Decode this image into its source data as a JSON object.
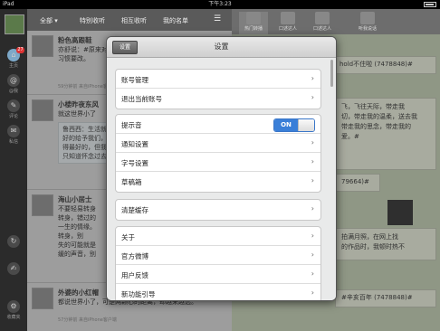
{
  "statusbar": {
    "carrier": "iPad",
    "time": "下午3:23"
  },
  "rail": {
    "items": [
      {
        "label": "主页",
        "icon": "home-icon"
      },
      {
        "label": "@我",
        "icon": "at-icon"
      },
      {
        "label": "评论",
        "icon": "comment-icon"
      },
      {
        "label": "私信",
        "icon": "message-icon"
      },
      {
        "label": "",
        "icon": "refresh-icon"
      },
      {
        "label": "",
        "icon": "compose-icon"
      },
      {
        "label": "收藏夹",
        "icon": "gear-icon"
      }
    ],
    "badge": "27"
  },
  "tabs": {
    "all": "全部 ▾",
    "special": "特别收听",
    "mutual": "相互收听",
    "mylist": "我的名单"
  },
  "feed": [
    {
      "name": "粉色高跟鞋",
      "text": "亦舒说：#原来对陌生人太\n习惯要改。",
      "meta": "59分钟前 来自iPhone客户端"
    },
    {
      "name": "小楼昨夜东风",
      "text": "就这世界小了",
      "quote": "鲁西西：生活就是\n好的给予我们，\n得最好的，但我们\n只知道怀念过去…",
      "meta": ""
    },
    {
      "name": "海山小居士",
      "text": "不要轻易转身\n转身，错过的\n一生的情缘。\n转身，别\n失的可能就是\n缓的声音，别",
      "meta": ""
    },
    {
      "name": "外婆的小红帽",
      "text": "都说世界小了，可是两颗心的距离，却越来越远。",
      "meta": "57分钟前 来自iPhone客户端"
    }
  ],
  "right": {
    "tabs": [
      "热门转播",
      "口述达人",
      "口述达人",
      "听我说话"
    ],
    "card1": "hold不住啦 (7478848)#",
    "card2": "飞，飞往天际，带走我\n切，带走我的温柔，送去我\n带走我的思念，带走我的\n爱。#",
    "card3": "79664)#",
    "card4": "拍满月照，在网上找\n的作品时，我顿时热不",
    "card5": "#辛亥百年 (7478848)#"
  },
  "settings": {
    "title": "设置",
    "back": "设置",
    "account": {
      "manage": "账号管理",
      "logout": "退出当前账号"
    },
    "notify": {
      "sound": "提示音",
      "sound_state": "ON",
      "notifications": "通知设置",
      "fontsize": "字号设置",
      "drafts": "草稿箱"
    },
    "cache": {
      "clear": "清楚缓存"
    },
    "about": {
      "about": "关于",
      "official": "官方微博",
      "feedback": "用户反馈",
      "guide": "新功能引导"
    }
  }
}
